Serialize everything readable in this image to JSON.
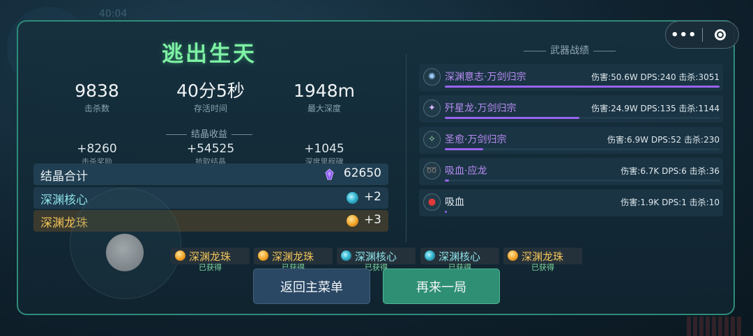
{
  "background": {
    "clock": "40:04"
  },
  "capsule": {
    "more_icon": "•••",
    "close_icon": "target-circle"
  },
  "title": "逃出生天",
  "stats": [
    {
      "value": "9838",
      "label": "击杀数"
    },
    {
      "value": "40分5秒",
      "label": "存活时间"
    },
    {
      "value": "1948m",
      "label": "最大深度"
    }
  ],
  "crystal_section": {
    "header": "结晶收益",
    "items": [
      {
        "value": "+8260",
        "label": "击杀奖励"
      },
      {
        "value": "+54525",
        "label": "拾取结晶"
      },
      {
        "value": "+1045",
        "label": "深度里程碑"
      }
    ]
  },
  "totals": [
    {
      "name": "结晶合计",
      "icon": "purple-crystal-icon",
      "value": "62650"
    },
    {
      "name": "深渊核心",
      "icon": "abyss-core-icon",
      "value": "+2"
    },
    {
      "name": "深渊龙珠",
      "icon": "dragon-pearl-icon",
      "value": "+3"
    }
  ],
  "weapons_header": "武器战绩",
  "weapons": [
    {
      "name": "深渊意志·万剑归宗",
      "stats": "伤害:50.6W DPS:240 击杀:3051",
      "progress": 1.0,
      "icon": "abyss-will-icon"
    },
    {
      "name": "歼星龙·万剑归宗",
      "stats": "伤害:24.9W DPS:135 击杀:1144",
      "progress": 0.49,
      "icon": "star-dragon-icon"
    },
    {
      "name": "圣愈·万剑归宗",
      "stats": "伤害:6.9W DPS:52 击杀:230",
      "progress": 0.14,
      "icon": "holy-heal-icon"
    },
    {
      "name": "吸血·应龙",
      "stats": "伤害:6.7K DPS:6 击杀:36",
      "progress": 0.014,
      "icon": "vampire-dragon-icon"
    },
    {
      "name": "吸血",
      "stats": "伤害:1.9K DPS:1 击杀:10",
      "progress": 0.004,
      "icon": "vampire-icon"
    }
  ],
  "rewards": [
    {
      "name": "深渊龙珠",
      "status": "已获得",
      "icon": "dragon-pearl-icon"
    },
    {
      "name": "深渊龙珠",
      "status": "已获得",
      "icon": "dragon-pearl-icon"
    },
    {
      "name": "深渊核心",
      "status": "已获得",
      "icon": "abyss-core-icon"
    },
    {
      "name": "深渊核心",
      "status": "已获得",
      "icon": "abyss-core-icon"
    },
    {
      "name": "深渊龙珠",
      "status": "已获得",
      "icon": "dragon-pearl-icon"
    }
  ],
  "buttons": {
    "back": "返回主菜单",
    "again": "再来一局"
  },
  "colors": {
    "title": "#7ef2a4",
    "accent_border": "#2f8b79",
    "weapon_name": "#b98df3",
    "pearl": "#f2c45a",
    "core": "#8fe3e9",
    "bar": "#9a64ef"
  }
}
